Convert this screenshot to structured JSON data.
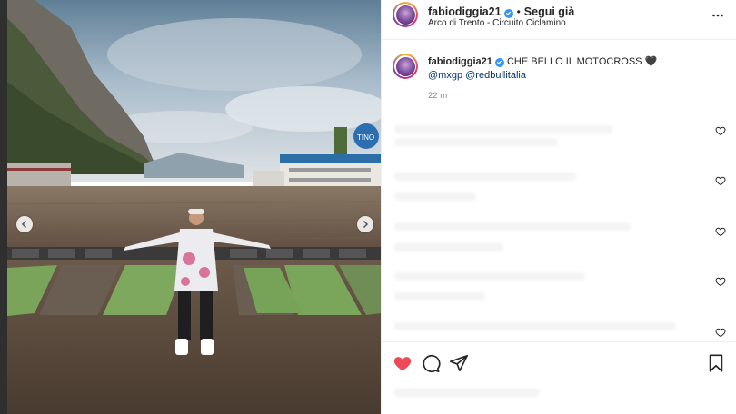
{
  "header": {
    "username": "fabiodiggia21",
    "separator": "•",
    "follow_label": "Segui già",
    "location": "Arco di Trento - Circuito Ciclamino"
  },
  "caption": {
    "username": "fabiodiggia21",
    "text": "CHE BELLO IL MOTOCROSS",
    "emoji": "🖤",
    "tag1": "@mxgp",
    "tag2": "@redbullitalia",
    "time": "22 m"
  },
  "icons": {
    "verified": "verified-badge-icon",
    "more": "more-options-icon",
    "like": "heart-filled-icon",
    "comment": "comment-icon",
    "share": "send-icon",
    "save": "bookmark-icon",
    "prev": "chevron-left-icon",
    "next": "chevron-right-icon"
  },
  "colors": {
    "like": "#ed4956",
    "verified": "#3897f0",
    "mention": "#00376b",
    "muted": "#8e8e8e"
  },
  "photo": {
    "banner_text": "TINO"
  }
}
